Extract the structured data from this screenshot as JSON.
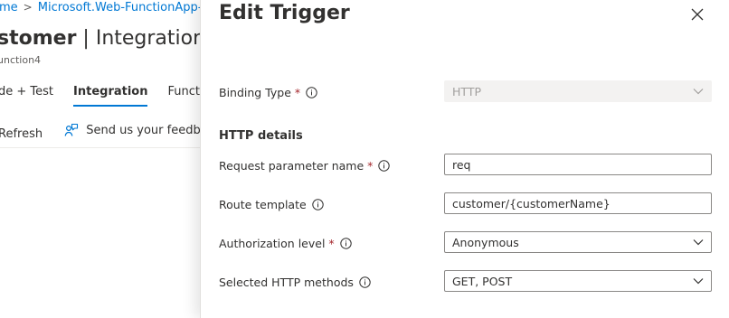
{
  "background": {
    "breadcrumb": {
      "home": "me",
      "resource": "Microsoft.Web-FunctionApp-Po"
    },
    "title": {
      "name": "stomer",
      "separator": " | ",
      "section": "Integration"
    },
    "subtitle": "unction4",
    "tabs": [
      {
        "label": "de + Test",
        "active": false
      },
      {
        "label": "Integration",
        "active": true
      },
      {
        "label": "Function",
        "active": false
      }
    ],
    "commands": {
      "refresh": "Refresh",
      "feedback": "Send us your feedback"
    }
  },
  "panel": {
    "title": "Edit Trigger",
    "binding_type": {
      "label": "Binding Type",
      "required": "*",
      "value": "HTTP"
    },
    "section_title": "HTTP details",
    "request_param": {
      "label": "Request parameter name",
      "required": "*",
      "value": "req"
    },
    "route_template": {
      "label": "Route template",
      "value": "customer/{customerName}"
    },
    "auth_level": {
      "label": "Authorization level",
      "required": "*",
      "value": "Anonymous"
    },
    "http_methods": {
      "label": "Selected HTTP methods",
      "value": "GET, POST"
    }
  },
  "colors": {
    "accent": "#0078d4",
    "required": "#a4262c",
    "text": "#323130"
  }
}
